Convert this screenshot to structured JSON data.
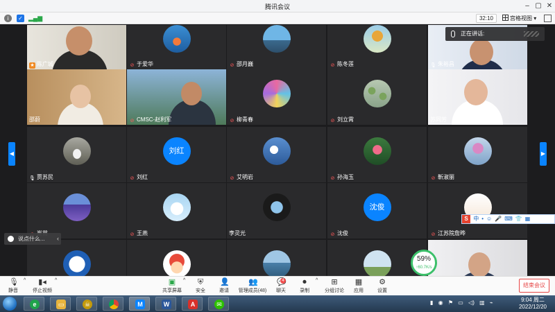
{
  "window": {
    "title": "腾讯会议"
  },
  "toolbar": {
    "timer": "32:10",
    "view_label": "宫格视图"
  },
  "speaking": {
    "label": "正在讲话:"
  },
  "tiles": [
    {
      "name": "陈广城",
      "kind": "video",
      "scene": "man-home",
      "mic": "host"
    },
    {
      "name": "于爱华",
      "kind": "avatar",
      "avatar": "fish",
      "mic": "muted"
    },
    {
      "name": "邵月巍",
      "kind": "avatar",
      "avatar": "sea",
      "mic": "muted"
    },
    {
      "name": "陈冬莲",
      "kind": "avatar",
      "avatar": "tree",
      "mic": "muted"
    },
    {
      "name": "朱裕昌",
      "kind": "video",
      "scene": "man-office",
      "mic": "on"
    },
    {
      "name": "邵蔚",
      "kind": "video",
      "scene": "woman-shelf",
      "mic": "none"
    },
    {
      "name": "CMSC-赵利军",
      "kind": "video",
      "scene": "man-landscape",
      "mic": "muted"
    },
    {
      "name": "柳青春",
      "kind": "avatar",
      "avatar": "shell",
      "mic": "muted"
    },
    {
      "name": "刘立霄",
      "kind": "avatar",
      "avatar": "lotus-pond",
      "mic": "muted"
    },
    {
      "name": "苏同芳",
      "kind": "video",
      "scene": "woman-white",
      "mic": "none"
    },
    {
      "name": "贾苏民",
      "kind": "avatar",
      "avatar": "horse",
      "mic": "on"
    },
    {
      "name": "刘红",
      "kind": "text",
      "avatar_text": "刘红",
      "mic": "muted"
    },
    {
      "name": "艾明岩",
      "kind": "avatar",
      "avatar": "blossom",
      "mic": "muted"
    },
    {
      "name": "孙海玉",
      "kind": "avatar",
      "avatar": "lotus",
      "mic": "muted"
    },
    {
      "name": "靳淑丽",
      "kind": "avatar",
      "avatar": "magnolia",
      "mic": "muted"
    },
    {
      "name": "崔苗",
      "kind": "avatar",
      "avatar": "lavender",
      "mic": "muted"
    },
    {
      "name": "王燕",
      "kind": "avatar",
      "avatar": "bunny",
      "mic": "muted"
    },
    {
      "name": "李灵光",
      "kind": "avatar",
      "avatar": "sky-eye",
      "mic": "none"
    },
    {
      "name": "沈俊",
      "kind": "text",
      "avatar_text": "沈俊",
      "mic": "muted"
    },
    {
      "name": "江苏院詹晔",
      "kind": "avatar",
      "avatar": "text-card",
      "mic": "muted"
    },
    {
      "name": "",
      "kind": "avatar",
      "avatar": "logo",
      "mic": "none"
    },
    {
      "name": "",
      "kind": "avatar",
      "avatar": "cartoon",
      "mic": "none"
    },
    {
      "name": "",
      "kind": "avatar",
      "avatar": "lake",
      "mic": "none"
    },
    {
      "name": "",
      "kind": "avatar",
      "avatar": "monument",
      "mic": "none"
    },
    {
      "name": "",
      "kind": "video",
      "scene": "man-mask",
      "mic": "none"
    }
  ],
  "chat_hint": {
    "text": "说点什么..."
  },
  "ime": {
    "items": [
      "中",
      "•",
      "☺",
      "🎤",
      "⌨",
      "👕",
      "▦"
    ]
  },
  "speed_badge": {
    "percent": "59%",
    "rate": "↑60.7K/s"
  },
  "controls": {
    "mute": "静音",
    "stop_video": "停止视频",
    "share_screen": "共享屏幕",
    "security": "安全",
    "invite": "邀请",
    "manage_members": "管理成员(48)",
    "chat": "聊天",
    "chat_badge": "4",
    "record": "录制",
    "breakout": "分组讨论",
    "apps": "应用",
    "settings": "设置",
    "end_meeting": "结束会议"
  },
  "taskbar": {
    "time": "9:04 周二",
    "date": "2022/12/20"
  },
  "colors": {
    "accent": "#0a84ff",
    "end": "#e64545",
    "muted": "#ff5a5a",
    "host": "#f08a24"
  }
}
